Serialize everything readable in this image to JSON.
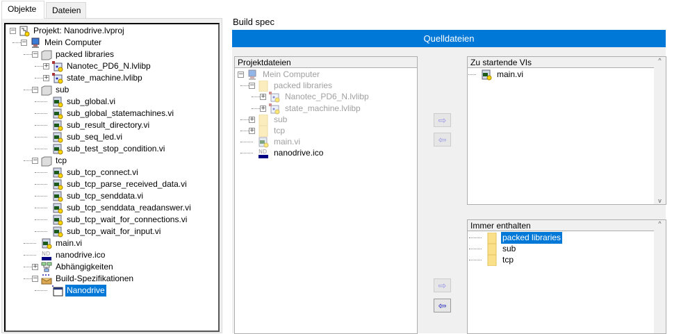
{
  "tabs": [
    {
      "label": "Objekte",
      "active": true
    },
    {
      "label": "Dateien",
      "active": false
    }
  ],
  "project_tree": [
    {
      "depth": 0,
      "exp": "-",
      "icon": "project",
      "label": "Projekt: Nanodrive.lvproj"
    },
    {
      "depth": 1,
      "exp": "-",
      "icon": "computer",
      "label": "Mein Computer"
    },
    {
      "depth": 2,
      "exp": "-",
      "icon": "folder-gray",
      "label": "packed libraries"
    },
    {
      "depth": 3,
      "exp": "+",
      "icon": "lvlibp",
      "label": "Nanotec_PD6_N.lvlibp"
    },
    {
      "depth": 3,
      "exp": "+",
      "icon": "lvlibp",
      "label": "state_machine.lvlibp"
    },
    {
      "depth": 2,
      "exp": "-",
      "icon": "folder-gray",
      "label": "sub"
    },
    {
      "depth": 3,
      "icon": "vi",
      "label": "sub_global.vi"
    },
    {
      "depth": 3,
      "icon": "vi",
      "label": "sub_global_statemachines.vi"
    },
    {
      "depth": 3,
      "icon": "vi",
      "label": "sub_result_directory.vi"
    },
    {
      "depth": 3,
      "icon": "vi",
      "label": "sub_seq_led.vi"
    },
    {
      "depth": 3,
      "icon": "vi",
      "label": "sub_test_stop_condition.vi"
    },
    {
      "depth": 2,
      "exp": "-",
      "icon": "folder-gray",
      "label": "tcp"
    },
    {
      "depth": 3,
      "icon": "vi",
      "label": "sub_tcp_connect.vi"
    },
    {
      "depth": 3,
      "icon": "vi",
      "label": "sub_tcp_parse_received_data.vi"
    },
    {
      "depth": 3,
      "icon": "vi",
      "label": "sub_tcp_senddata.vi"
    },
    {
      "depth": 3,
      "icon": "vi",
      "label": "sub_tcp_senddata_readanswer.vi"
    },
    {
      "depth": 3,
      "icon": "vi",
      "label": "sub_tcp_wait_for_connections.vi"
    },
    {
      "depth": 3,
      "icon": "vi",
      "label": "sub_tcp_wait_for_input.vi"
    },
    {
      "depth": 2,
      "icon": "vi",
      "label": "main.vi"
    },
    {
      "depth": 2,
      "icon": "ico",
      "label": "nanodrive.ico"
    },
    {
      "depth": 2,
      "exp": "+",
      "icon": "dependencies",
      "label": "Abhängigkeiten"
    },
    {
      "depth": 2,
      "exp": "-",
      "icon": "build",
      "label": "Build-Spezifikationen"
    },
    {
      "depth": 3,
      "icon": "app",
      "label": "Nanodrive",
      "selected": true
    }
  ],
  "build_spec": {
    "title": "Build spec",
    "section": "Quelldateien",
    "project_files": {
      "header": "Projektdateien",
      "items": [
        {
          "depth": 0,
          "exp": "-",
          "icon": "computer",
          "label": "Mein Computer",
          "dim": true
        },
        {
          "depth": 1,
          "exp": "-",
          "icon": "folder",
          "label": "packed libraries",
          "dim": true
        },
        {
          "depth": 2,
          "exp": "+",
          "icon": "lvlibp",
          "label": "Nanotec_PD6_N.lvlibp",
          "dim": true
        },
        {
          "depth": 2,
          "exp": "+",
          "icon": "lvlibp",
          "label": "state_machine.lvlibp",
          "dim": true
        },
        {
          "depth": 1,
          "exp": "+",
          "icon": "folder",
          "label": "sub",
          "dim": true
        },
        {
          "depth": 1,
          "exp": "+",
          "icon": "folder",
          "label": "tcp",
          "dim": true
        },
        {
          "depth": 1,
          "icon": "vi",
          "label": "main.vi",
          "dim": true
        },
        {
          "depth": 1,
          "icon": "ico",
          "label": "nanodrive.ico",
          "dim": false
        }
      ]
    },
    "startup_vis": {
      "header": "Zu startende VIs",
      "items": [
        {
          "depth": 0,
          "icon": "vi",
          "label": "main.vi"
        }
      ]
    },
    "always_included": {
      "header": "Immer enthalten",
      "items": [
        {
          "depth": 0,
          "icon": "folder",
          "label": "packed libraries",
          "selected": true
        },
        {
          "depth": 0,
          "icon": "folder",
          "label": "sub"
        },
        {
          "depth": 0,
          "icon": "folder",
          "label": "tcp"
        }
      ]
    },
    "arrows": {
      "right": "⇨",
      "left": "⇦"
    }
  },
  "colors": {
    "accent": "#0078d7",
    "arrow_enabled": "#2020c0",
    "arrow_disabled": "#9a9ae6"
  }
}
